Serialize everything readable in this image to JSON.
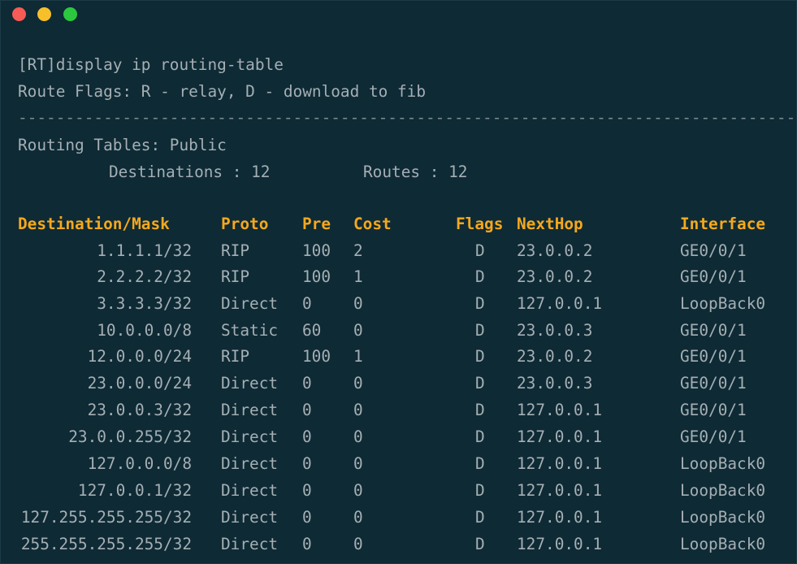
{
  "window": {
    "controls": [
      "close",
      "minimize",
      "maximize"
    ]
  },
  "terminal": {
    "command_line": "[RT]display ip routing-table",
    "flags_line": "Route Flags: R - relay, D - download to fib",
    "separator": "------------------------------------------------------------------------------------------------------------",
    "tables_line": "Routing Tables: Public",
    "destinations_label": "Destinations : 12",
    "routes_label": "Routes : 12",
    "headers": {
      "destination": "Destination/Mask",
      "proto": "Proto",
      "pre": "Pre",
      "cost": "Cost",
      "flags": "Flags",
      "nexthop": "NextHop",
      "interface": "Interface"
    },
    "routes": [
      {
        "dest": "1.1.1.1/32",
        "proto": "RIP",
        "pre": "100",
        "cost": "2",
        "flags": "D",
        "nexthop": "23.0.0.2",
        "iface": "GE0/0/1"
      },
      {
        "dest": "2.2.2.2/32",
        "proto": "RIP",
        "pre": "100",
        "cost": "1",
        "flags": "D",
        "nexthop": "23.0.0.2",
        "iface": "GE0/0/1"
      },
      {
        "dest": "3.3.3.3/32",
        "proto": "Direct",
        "pre": "0",
        "cost": "0",
        "flags": "D",
        "nexthop": "127.0.0.1",
        "iface": "LoopBack0"
      },
      {
        "dest": "10.0.0.0/8",
        "proto": "Static",
        "pre": "60",
        "cost": "0",
        "flags": "D",
        "nexthop": "23.0.0.3",
        "iface": "GE0/0/1"
      },
      {
        "dest": "12.0.0.0/24",
        "proto": "RIP",
        "pre": "100",
        "cost": "1",
        "flags": "D",
        "nexthop": "23.0.0.2",
        "iface": "GE0/0/1"
      },
      {
        "dest": "23.0.0.0/24",
        "proto": "Direct",
        "pre": "0",
        "cost": "0",
        "flags": "D",
        "nexthop": "23.0.0.3",
        "iface": "GE0/0/1"
      },
      {
        "dest": "23.0.0.3/32",
        "proto": "Direct",
        "pre": "0",
        "cost": "0",
        "flags": "D",
        "nexthop": "127.0.0.1",
        "iface": "GE0/0/1"
      },
      {
        "dest": "23.0.0.255/32",
        "proto": "Direct",
        "pre": "0",
        "cost": "0",
        "flags": "D",
        "nexthop": "127.0.0.1",
        "iface": "GE0/0/1"
      },
      {
        "dest": "127.0.0.0/8",
        "proto": "Direct",
        "pre": "0",
        "cost": "0",
        "flags": "D",
        "nexthop": "127.0.0.1",
        "iface": "LoopBack0"
      },
      {
        "dest": "127.0.0.1/32",
        "proto": "Direct",
        "pre": "0",
        "cost": "0",
        "flags": "D",
        "nexthop": "127.0.0.1",
        "iface": "LoopBack0"
      },
      {
        "dest": "127.255.255.255/32",
        "proto": "Direct",
        "pre": "0",
        "cost": "0",
        "flags": "D",
        "nexthop": "127.0.0.1",
        "iface": "LoopBack0"
      },
      {
        "dest": "255.255.255.255/32",
        "proto": "Direct",
        "pre": "0",
        "cost": "0",
        "flags": "D",
        "nexthop": "127.0.0.1",
        "iface": "LoopBack0"
      }
    ]
  },
  "colors": {
    "background": "#0e2a35",
    "text": "#a5afb4",
    "header": "#f5a81d",
    "close": "#f75b55",
    "minimize": "#f7bf2a",
    "maximize": "#2bc83f"
  }
}
